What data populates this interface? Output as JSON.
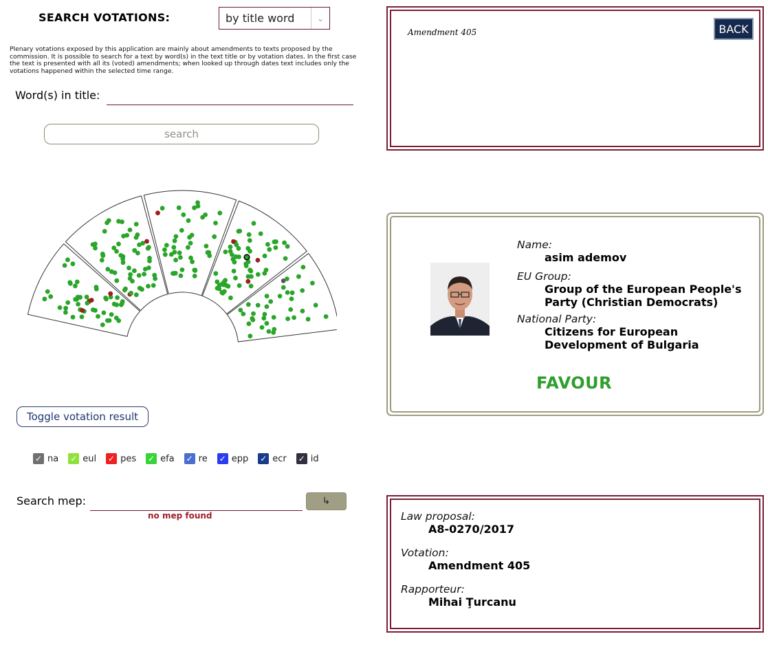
{
  "search": {
    "title": "SEARCH VOTATIONS:",
    "mode_value": "by title word",
    "intro_text": "Plenary votations exposed by this application are mainly about amendments to texts proposed by the commission. It is possible to search for a text by word(s) in the text title or by votation dates. In the first case the text is presented with all its (voted) amendments; when looked up through dates text includes only the votations happened within the selected time range.",
    "word_label": "Word(s) in title:",
    "word_value": "",
    "search_button": "search"
  },
  "toggle_button": "Toggle votation result",
  "legend": [
    {
      "label": "na",
      "color": "#707070"
    },
    {
      "label": "eul",
      "color": "#8fe23a"
    },
    {
      "label": "pes",
      "color": "#ee2020"
    },
    {
      "label": "efa",
      "color": "#38d438"
    },
    {
      "label": "re",
      "color": "#4a6fd0"
    },
    {
      "label": "epp",
      "color": "#2a3cf0"
    },
    {
      "label": "ecr",
      "color": "#1a3a8a"
    },
    {
      "label": "id",
      "color": "#303040"
    }
  ],
  "mep_search": {
    "label": "Search mep:",
    "value": "",
    "go_symbol": "↳",
    "message": "no mep found"
  },
  "vote_box": {
    "title": "Amendment 405",
    "back_button": "BACK"
  },
  "mep_card": {
    "name_label": "Name:",
    "name": "asim ademov",
    "group_label": "EU Group:",
    "group": "Group of the European People's Party (Christian Democrats)",
    "party_label": "National Party:",
    "party": "Citizens for European Development of Bulgaria",
    "vote": "FAVOUR",
    "vote_color": "#2e9e2e"
  },
  "law_box": {
    "law_label": "Law proposal:",
    "law": "A8-0270/2017",
    "votation_label": "Votation:",
    "votation": "Amendment 405",
    "rapporteur_label": "Rapporteur:",
    "rapporteur": "Mihai Ţurcanu"
  },
  "colors": {
    "favour": "#2aa52a",
    "against": "#9e1d1d",
    "abstain": "#555555",
    "frame": "#7a1d35"
  }
}
